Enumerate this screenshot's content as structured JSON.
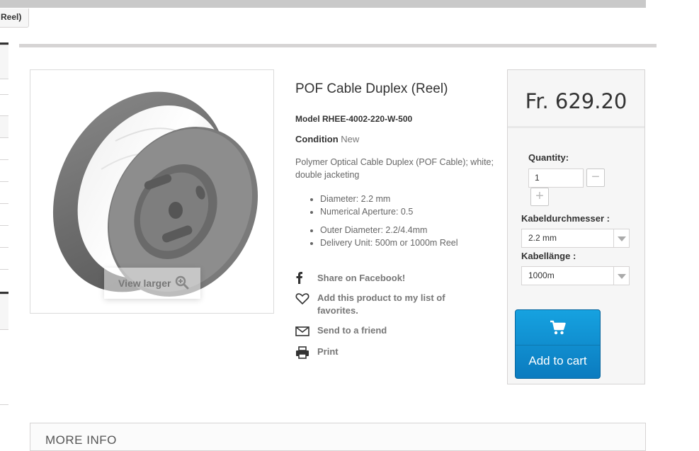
{
  "breadcrumb": {
    "tail": "Reel)"
  },
  "product": {
    "title": "POF Cable Duplex (Reel)",
    "model_label": "Model",
    "model": "RHEE-4002-220-W-500",
    "condition_label": "Condition",
    "condition": "New",
    "description": "Polymer Optical Cable Duplex (POF Cable); white; double jacketing",
    "specs": [
      "Diameter: 2.2 mm",
      "Numerical Aperture: 0.5",
      "Outer Diameter: 2.2/4.4mm",
      "Delivery Unit: 500m or 1000m Reel"
    ],
    "view_larger": "View larger"
  },
  "actions": {
    "facebook": "Share on Facebook!",
    "favorites": "Add this product to my list of favorites.",
    "friend": "Send to a friend",
    "print": "Print"
  },
  "buy": {
    "price": "Fr. 629.20",
    "quantity_label": "Quantity:",
    "quantity": "1",
    "minus": "−",
    "plus": "+",
    "diameter_label": "Kabeldurchmesser :",
    "diameter_value": "2.2 mm",
    "length_label": "Kabellänge :",
    "length_value": "1000m",
    "add_to_cart": "Add to cart"
  },
  "more_info": "MORE INFO",
  "colors": {
    "accent": "#0e91d3",
    "border": "#d6d4d4"
  },
  "icons": [
    "zoom-icon",
    "facebook-icon",
    "heart-icon",
    "envelope-icon",
    "print-icon",
    "cart-icon"
  ]
}
